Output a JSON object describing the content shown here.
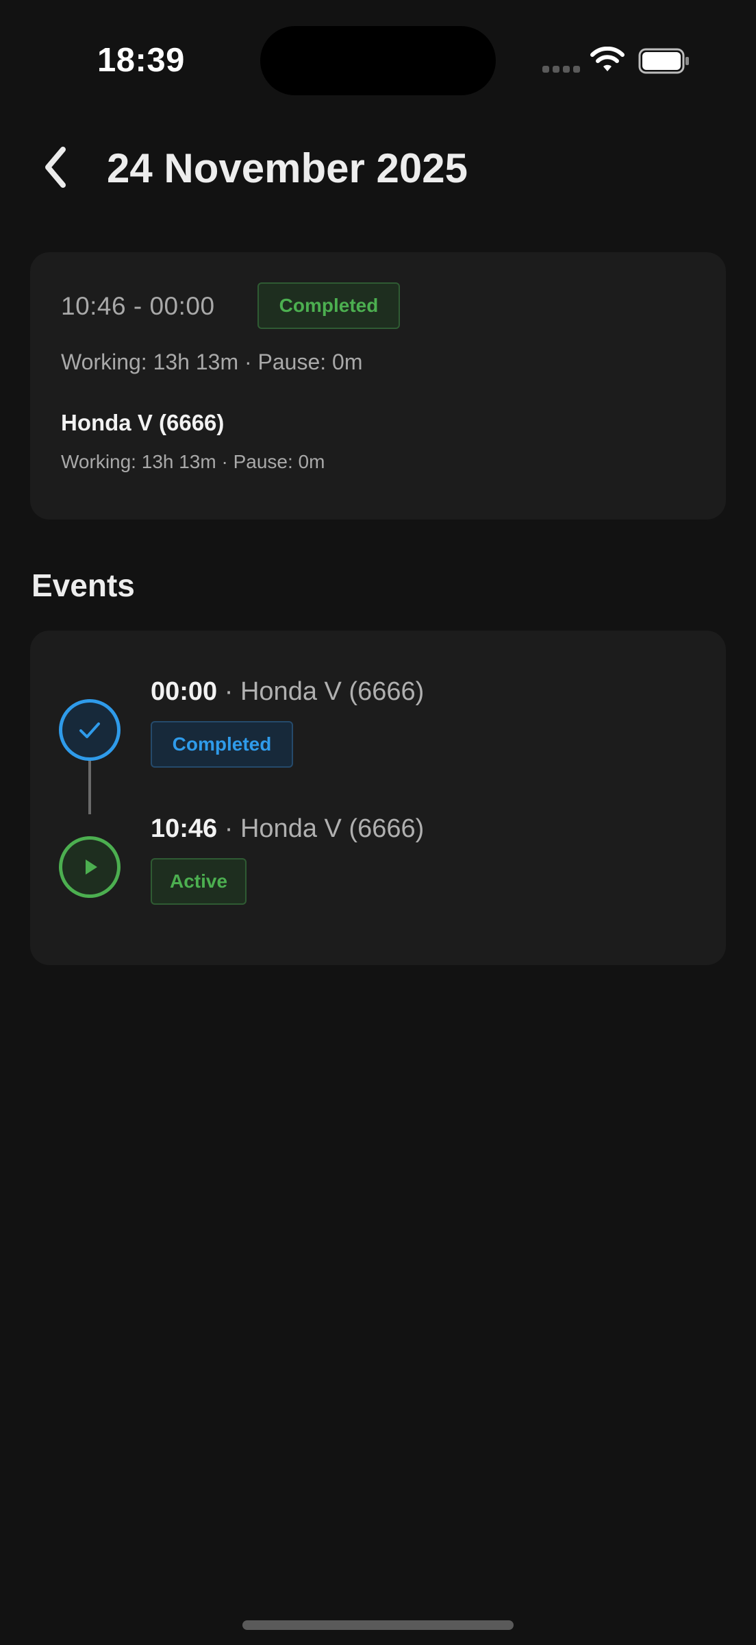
{
  "status_bar": {
    "time": "18:39"
  },
  "header": {
    "title": "24 November 2025",
    "back_icon": "chevron-left-icon"
  },
  "summary": {
    "time_range": "10:46 - 00:00",
    "status_badge": "Completed",
    "totals": "Working: 13h 13m · Pause: 0m",
    "vehicle": {
      "name": "Honda V (6666)",
      "totals": "Working: 13h 13m · Pause: 0m"
    }
  },
  "events_section": {
    "title": "Events",
    "separator": "·",
    "items": [
      {
        "time": "00:00",
        "vehicle": "Honda V (6666)",
        "status": "Completed",
        "icon": "check-icon",
        "color": "#2F9BEA"
      },
      {
        "time": "10:46",
        "vehicle": "Honda V (6666)",
        "status": "Active",
        "icon": "play-icon",
        "color": "#4CAF50"
      }
    ]
  },
  "colors": {
    "background": "#121212",
    "card": "#1C1C1C",
    "green_accent": "#4CAF50",
    "blue_accent": "#2F9BEA"
  }
}
